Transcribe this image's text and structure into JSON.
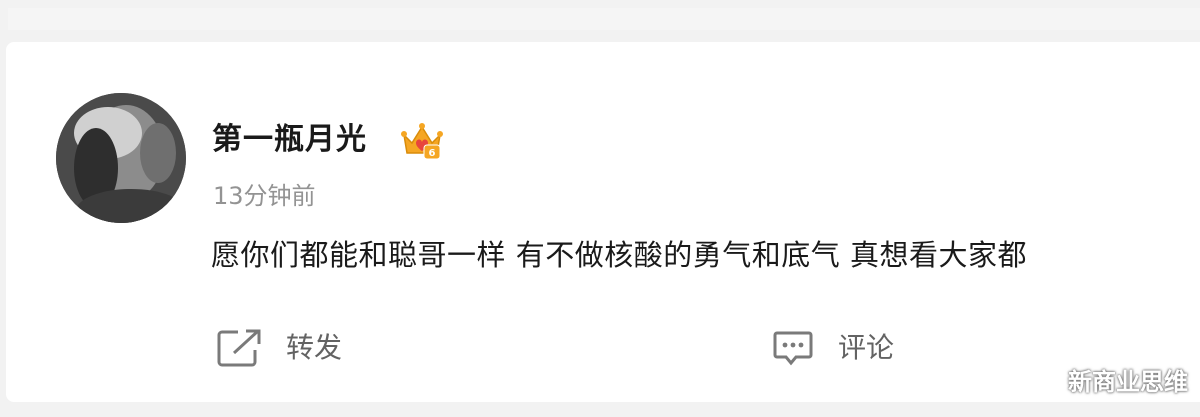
{
  "post": {
    "username": "第一瓶月光",
    "badge_icon": "crown-badge-icon",
    "badge_colors": {
      "crown": "#f5a623",
      "heart": "#e8453c"
    },
    "time": "13分钟前",
    "text": "愿你们都能和聪哥一样 有不做核酸的勇气和底气 真想看大家都",
    "actions": {
      "repost_label": "转发",
      "comment_label": "评论"
    }
  },
  "watermark": "新商业思维"
}
